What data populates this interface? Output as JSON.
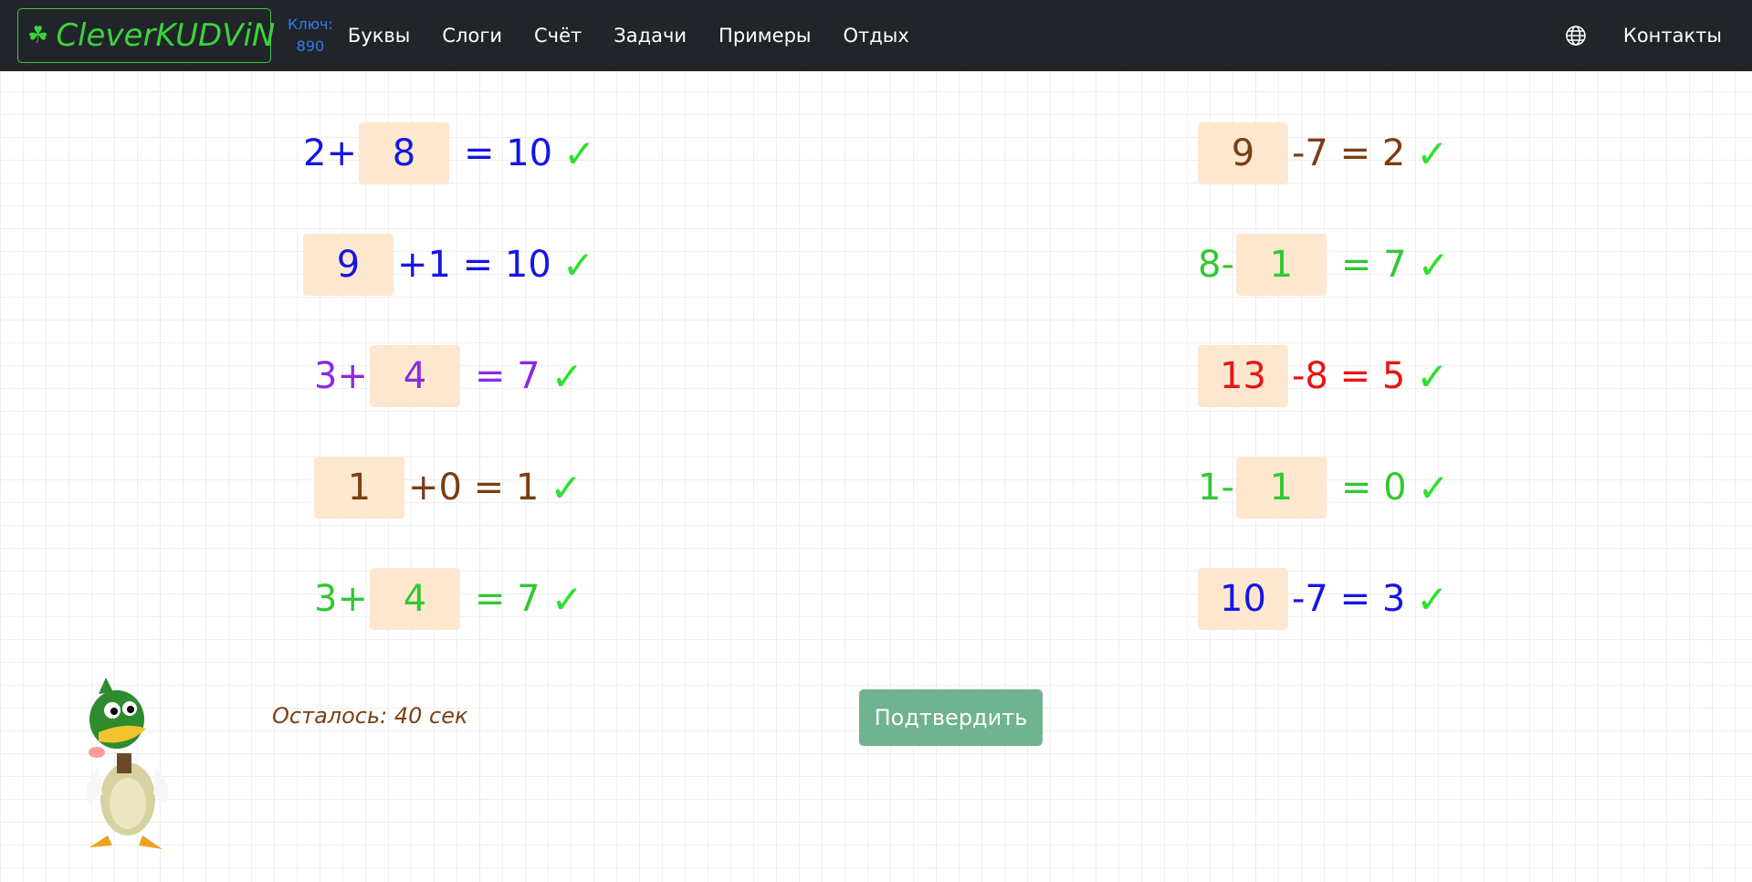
{
  "nav": {
    "brand": "CleverKUDViN",
    "brand_icon": "clover-icon",
    "key_label": "Ключ:",
    "key_value": "890",
    "items": [
      {
        "label": "Буквы"
      },
      {
        "label": "Слоги"
      },
      {
        "label": "Счёт"
      },
      {
        "label": "Задачи"
      },
      {
        "label": "Примеры"
      },
      {
        "label": "Отдых"
      }
    ],
    "contacts": "Контакты",
    "globe_icon": "globe-icon"
  },
  "colors": {
    "navbar_bg": "#212529",
    "brand_green": "#3cd23c",
    "key_blue": "#2f7bf5",
    "answer_box": "#fde8cf",
    "check_green": "#2fe02f",
    "submit_bg": "#6fb391",
    "timer_brown": "#7a4216"
  },
  "equations": {
    "left": [
      {
        "pre": "2+",
        "box": "8",
        "post": "= 10",
        "check": "✓",
        "color": "#1515e6"
      },
      {
        "pre": "",
        "box": "9",
        "post": "+1 = 10",
        "check": "✓",
        "color": "#1515e6"
      },
      {
        "pre": "3+",
        "box": "4",
        "post": "= 7",
        "check": "✓",
        "color": "#8a2be2"
      },
      {
        "pre": "",
        "box": "1",
        "post": "+0 = 1",
        "check": "✓",
        "color": "#7a3e14"
      },
      {
        "pre": "3+",
        "box": "4",
        "post": "= 7",
        "check": "✓",
        "color": "#32c832"
      }
    ],
    "right": [
      {
        "pre": "",
        "box": "9",
        "post": "-7 = 2",
        "check": "✓",
        "color": "#7a3e14"
      },
      {
        "pre": "8-",
        "box": "1",
        "post": "= 7",
        "check": "✓",
        "color": "#32c832"
      },
      {
        "pre": "",
        "box": "13",
        "post": "-8 = 5",
        "check": "✓",
        "color": "#e61515"
      },
      {
        "pre": "1-",
        "box": "1",
        "post": "= 0",
        "check": "✓",
        "color": "#32c832"
      },
      {
        "pre": "",
        "box": "10",
        "post": "-7 = 3",
        "check": "✓",
        "color": "#1515e6"
      }
    ]
  },
  "timer_text": "Осталось: 40 сек",
  "submit_label": "Подтвердить",
  "mascot": "duck-mascot"
}
